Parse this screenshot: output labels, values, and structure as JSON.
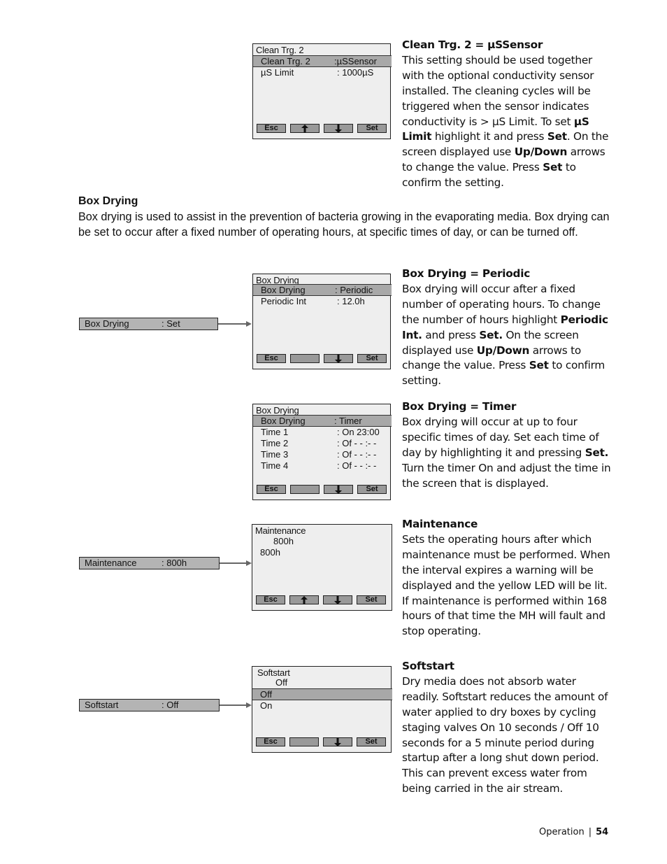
{
  "screens": {
    "clean_trg": {
      "title": "Clean Trg. 2",
      "rows": [
        {
          "label": "Clean Trg. 2",
          "value": ":µSSensor",
          "highlighted": true
        },
        {
          "label": "µS Limit",
          "value": ": 1000µS",
          "highlighted": false
        }
      ],
      "buttons": [
        "Esc",
        "up-arrow",
        "down-arrow",
        "Set"
      ]
    },
    "box_periodic": {
      "title": "Box Drying",
      "rows": [
        {
          "label": "Box Drying",
          "value": ": Periodic",
          "highlighted": true
        },
        {
          "label": "Periodic Int",
          "value": ": 12.0h",
          "highlighted": false
        }
      ],
      "buttons": [
        "Esc",
        "",
        "down-arrow",
        "Set"
      ]
    },
    "box_timer": {
      "title": "Box Drying",
      "rows": [
        {
          "label": "Box Drying",
          "value": ": Timer",
          "highlighted": true
        },
        {
          "label": "Time 1",
          "value": ": On 23:00",
          "highlighted": false
        },
        {
          "label": "Time 2",
          "value": ": Of  - - :- -",
          "highlighted": false
        },
        {
          "label": "Time 3",
          "value": ": Of  - - :- -",
          "highlighted": false
        },
        {
          "label": "Time 4",
          "value": ": Of  - - :- -",
          "highlighted": false
        }
      ],
      "buttons": [
        "Esc",
        "",
        "down-arrow",
        "Set"
      ]
    },
    "maintenance": {
      "title": "Maintenance",
      "current": "800h",
      "edit": "800h",
      "buttons": [
        "Esc",
        "up-arrow",
        "down-arrow",
        "Set"
      ]
    },
    "softstart": {
      "title": "Softstart",
      "current": "Off",
      "options": [
        {
          "label": "Off",
          "highlighted": true
        },
        {
          "label": "On",
          "highlighted": false
        }
      ],
      "buttons": [
        "Esc",
        "",
        "down-arrow",
        "Set"
      ]
    }
  },
  "pills": {
    "box_drying": {
      "label": "Box Drying",
      "value": ": Set"
    },
    "maintenance": {
      "label": "Maintenance",
      "value": ": 800h"
    },
    "softstart": {
      "label": "Softstart",
      "value": ": Off"
    }
  },
  "section": {
    "heading": "Box Drying",
    "body": "Box drying is used to assist in the prevention of bacteria growing in the evaporating media.  Box drying can be set to occur after a fixed number of operating hours, at specific times of day, or can be turned off."
  },
  "descriptions": {
    "clean_trg": {
      "heading": "Clean Trg. 2 = µSSensor",
      "parts": [
        "This setting should be used together with the optional conductivity sensor installed.  The cleaning cycles will be triggered when the sensor indicates conductivity is > µS Limit.  To set ",
        "µS Limit",
        " highlight it and press ",
        "Set",
        ". On the screen displayed use ",
        "Up/Down",
        " arrows to change the value. Press ",
        "Set",
        " to confirm the setting."
      ]
    },
    "box_periodic": {
      "heading": "Box Drying = Periodic",
      "parts": [
        "Box drying will occur after a fixed number of operating hours.  To change the number of hours highlight  ",
        "Periodic Int.",
        " and press ",
        "Set.",
        " On the screen displayed use ",
        "Up/Down",
        " arrows to change the value. Press ",
        "Set",
        " to confirm setting."
      ]
    },
    "box_timer": {
      "heading": "Box Drying = Timer",
      "parts": [
        "Box drying will occur at up to four specific times of day.  Set each time of day by highlighting it and pressing ",
        "Set.",
        " Turn the timer On and adjust the time in the screen that is displayed."
      ]
    },
    "maintenance": {
      "heading": "Maintenance",
      "body": "Sets the operating hours after which maintenance must be performed. When the interval expires a warning will be displayed and the yellow LED will be lit. If maintenance is performed within 168 hours of that time  the MH will fault and stop operating."
    },
    "softstart": {
      "heading": "Softstart",
      "body": "Dry media does not absorb water readily. Softstart reduces the amount of water applied to dry boxes by cycling staging valves On 10 seconds / Off 10 seconds for a 5 minute period during startup after a long shut down period. This can prevent excess water from being carried in the air stream."
    }
  },
  "footer": {
    "section": "Operation",
    "separator": "|",
    "page": "54"
  }
}
